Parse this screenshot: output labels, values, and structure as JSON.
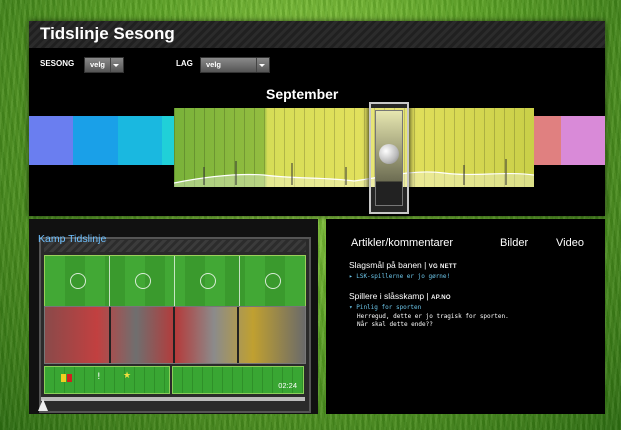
{
  "header": {
    "title": "Tidslinje Sesong"
  },
  "filters": {
    "season_label": "SESONG",
    "season_value": "velg",
    "team_label": "LAG",
    "team_value": "velg"
  },
  "timeline": {
    "month": "September",
    "colors": [
      "#6a7ef0",
      "#1aa0e8",
      "#1ab8e0",
      "#20d0d8",
      "#18d8b8",
      "#15c88a",
      "#3cb84a",
      "#6eb73a",
      "#d8d85a",
      "#e0c040",
      "#e8a030",
      "#e08080",
      "#d98ad8"
    ]
  },
  "match_timeline": {
    "title": "Kamp Tidslinje",
    "time": "02:24",
    "event_icons": [
      "yellow-card-icon",
      "red-card-icon",
      "exclamation-icon",
      "star-icon"
    ]
  },
  "articles": {
    "tabs": [
      "Artikler/kommentarer",
      "Bilder",
      "Video"
    ],
    "items": [
      {
        "title": "Slagsmål på banen",
        "source": "VG NETT",
        "sub": "▸ LSK-spillerne er jo gørne!"
      },
      {
        "title": "Spillere i slåsskamp",
        "source": "AP.NO",
        "sub": "▾ Pinlig for sporten",
        "body": "Herregud, dette er jo tragisk for sporten. Når skal dette ende??"
      }
    ]
  }
}
